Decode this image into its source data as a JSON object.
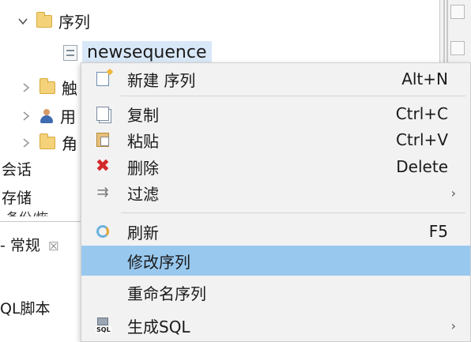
{
  "tree": {
    "folder_sequences": "序列",
    "selected_node": "newsequence",
    "partial_items": [
      "触",
      "用",
      "角"
    ],
    "session_label": "会话",
    "storage_label": "存储",
    "storage_clip": "备份/恢"
  },
  "tab": {
    "label": "- 常规",
    "close_glyph": "☒"
  },
  "editor": {
    "sql_script_label": "QL脚本"
  },
  "menu": {
    "items": [
      {
        "label": "新建 序列",
        "shortcut": "Alt+N",
        "icon": "new-icon"
      },
      {
        "label": "复制",
        "shortcut": "Ctrl+C",
        "icon": "copy-icon"
      },
      {
        "label": "粘贴",
        "shortcut": "Ctrl+V",
        "icon": "paste-icon"
      },
      {
        "label": "删除",
        "shortcut": "Delete",
        "icon": "delete-icon"
      },
      {
        "label": "过滤",
        "submenu_arrow": "›",
        "icon": "filter-icon"
      },
      {
        "label": "刷新",
        "shortcut": "F5",
        "icon": "refresh-icon"
      },
      {
        "label": "修改序列"
      },
      {
        "label": "重命名序列"
      },
      {
        "label": "生成SQL",
        "submenu_arrow": "›",
        "icon": "generate-sql-icon"
      }
    ],
    "sql_icon_text": "SQL"
  },
  "colors": {
    "highlight": "#99c8ef",
    "selection": "#d9e8f8",
    "menu_background": "#f2f2f2",
    "delete_red": "#d42a2a"
  }
}
